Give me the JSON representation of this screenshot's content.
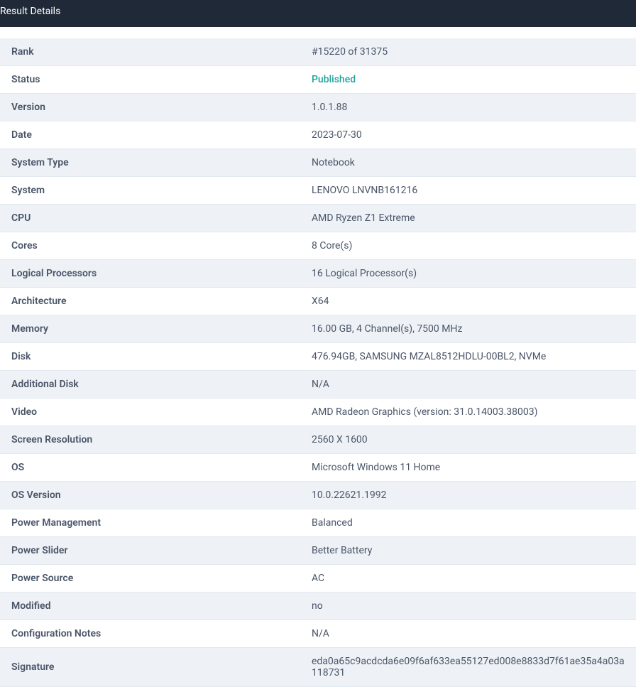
{
  "header": {
    "title": "Result Details"
  },
  "rows": [
    {
      "label": "Rank",
      "value": "#15220 of 31375",
      "cls": ""
    },
    {
      "label": "Status",
      "value": "Published",
      "cls": "status-published"
    },
    {
      "label": "Version",
      "value": "1.0.1.88",
      "cls": ""
    },
    {
      "label": "Date",
      "value": "2023-07-30",
      "cls": ""
    },
    {
      "label": "System Type",
      "value": "Notebook",
      "cls": ""
    },
    {
      "label": "System",
      "value": "LENOVO LNVNB161216",
      "cls": ""
    },
    {
      "label": "CPU",
      "value": "AMD Ryzen Z1 Extreme",
      "cls": ""
    },
    {
      "label": "Cores",
      "value": "8 Core(s)",
      "cls": ""
    },
    {
      "label": "Logical Processors",
      "value": "16 Logical Processor(s)",
      "cls": ""
    },
    {
      "label": "Architecture",
      "value": "X64",
      "cls": ""
    },
    {
      "label": "Memory",
      "value": "16.00 GB, 4 Channel(s), 7500 MHz",
      "cls": ""
    },
    {
      "label": "Disk",
      "value": "476.94GB, SAMSUNG MZAL8512HDLU-00BL2, NVMe",
      "cls": ""
    },
    {
      "label": "Additional Disk",
      "value": "N/A",
      "cls": ""
    },
    {
      "label": "Video",
      "value": "AMD Radeon Graphics (version: 31.0.14003.38003)",
      "cls": ""
    },
    {
      "label": "Screen Resolution",
      "value": "2560 X 1600",
      "cls": ""
    },
    {
      "label": "OS",
      "value": "Microsoft Windows 11 Home",
      "cls": ""
    },
    {
      "label": "OS Version",
      "value": "10.0.22621.1992",
      "cls": ""
    },
    {
      "label": "Power Management",
      "value": "Balanced",
      "cls": ""
    },
    {
      "label": "Power Slider",
      "value": "Better Battery",
      "cls": ""
    },
    {
      "label": "Power Source",
      "value": "AC",
      "cls": ""
    },
    {
      "label": "Modified",
      "value": "no",
      "cls": ""
    },
    {
      "label": "Configuration Notes",
      "value": "N/A",
      "cls": ""
    },
    {
      "label": "Signature",
      "value": "eda0a65c9acdcda6e09f6af633ea55127ed008e8833d7f61ae35a4a03a118731",
      "cls": ""
    }
  ]
}
